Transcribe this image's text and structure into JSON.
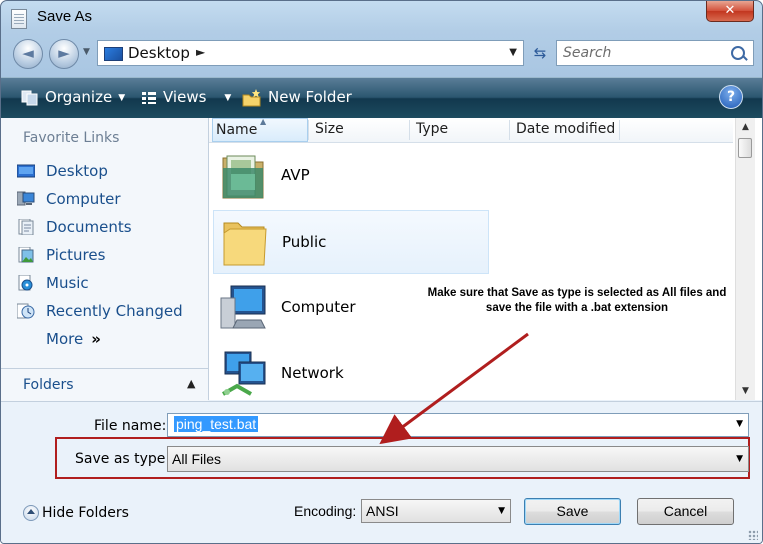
{
  "window": {
    "title": "Save As",
    "close_glyph": "✕"
  },
  "nav": {
    "back_glyph": "◄",
    "forward_glyph": "►",
    "dropdown_glyph": "▼"
  },
  "address": {
    "location": "Desktop",
    "arrow": "►",
    "dropdown": "▼",
    "refresh_glyph": "⇆"
  },
  "search": {
    "placeholder": "Search"
  },
  "toolbar": {
    "organize_label": "Organize",
    "views_label": "Views",
    "new_folder_label": "New Folder",
    "caret": "▼",
    "help_glyph": "?"
  },
  "favorites": {
    "title": "Favorite Links",
    "items": [
      {
        "label": "Desktop",
        "icon": "desktop-icon"
      },
      {
        "label": "Computer",
        "icon": "computer-icon"
      },
      {
        "label": "Documents",
        "icon": "documents-icon"
      },
      {
        "label": "Pictures",
        "icon": "pictures-icon"
      },
      {
        "label": "Music",
        "icon": "music-icon"
      },
      {
        "label": "Recently Changed",
        "icon": "recent-icon"
      },
      {
        "label": "More",
        "icon": "none"
      }
    ],
    "more_chevron": "»"
  },
  "folders": {
    "label": "Folders",
    "caret": "▲"
  },
  "columns": {
    "name": "Name",
    "size": "Size",
    "type": "Type",
    "date": "Date modified",
    "sort_glyph": "▲"
  },
  "scrollbar": {
    "up": "▲",
    "down": "▼"
  },
  "files": [
    {
      "name": "AVP",
      "icon": "program-folder-icon"
    },
    {
      "name": "Public",
      "icon": "folder-icon",
      "selected": true
    },
    {
      "name": "Computer",
      "icon": "computer-icon"
    },
    {
      "name": "Network",
      "icon": "network-icon"
    }
  ],
  "annotation": {
    "line1": "Make sure that Save as type is selected as All files and",
    "line2": "save the file with a .bat extension"
  },
  "form": {
    "file_name_label": "File name:",
    "file_name_value": "ping_test.bat",
    "save_type_label": "Save as type:",
    "save_type_value": "All Files",
    "encoding_label": "Encoding:",
    "encoding_value": "ANSI",
    "dropdown_glyph": "▼"
  },
  "buttons": {
    "hide_folders": "Hide Folders",
    "save": "Save",
    "cancel": "Cancel"
  },
  "colors": {
    "annotation_red": "#b01e1e",
    "toolbar_dark": "#12384e",
    "link_blue": "#1a4f8c",
    "selection_blue": "#3399ff"
  }
}
